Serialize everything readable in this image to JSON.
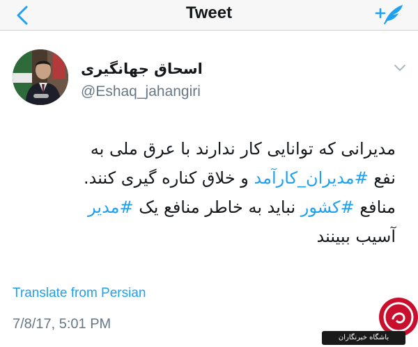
{
  "navbar": {
    "title": "Tweet",
    "back_icon": "chevron-left-icon",
    "compose_icon": "compose-tweet-icon",
    "accent_color": "#1da1f2"
  },
  "tweet": {
    "author": {
      "name": "اسحاق جهانگیری",
      "handle": "@Eshaq_jahangiri",
      "avatar_icon": "profile-photo"
    },
    "text": {
      "line1": "مدیرانی که توانایی کار ندارند با عرق ملی به",
      "line2_before": "نفع ",
      "line2_hashtag": "#مدیران_کارآمد",
      "line2_after": " و خلاق کناره گیری کنند.",
      "line3_before": "منافع ",
      "line3_hashtag1": "#کشور",
      "line3_middle": " نباید به خاطر منافع یک ",
      "line3_hashtag2": "#مدیر",
      "line4": "آسیب ببینند"
    },
    "translate_label": "Translate from Persian",
    "timestamp": "7/8/17, 5:01 PM",
    "hashtag_color": "#1da1f2"
  },
  "watermark": {
    "text": "باشگاه خبرنگاران"
  }
}
